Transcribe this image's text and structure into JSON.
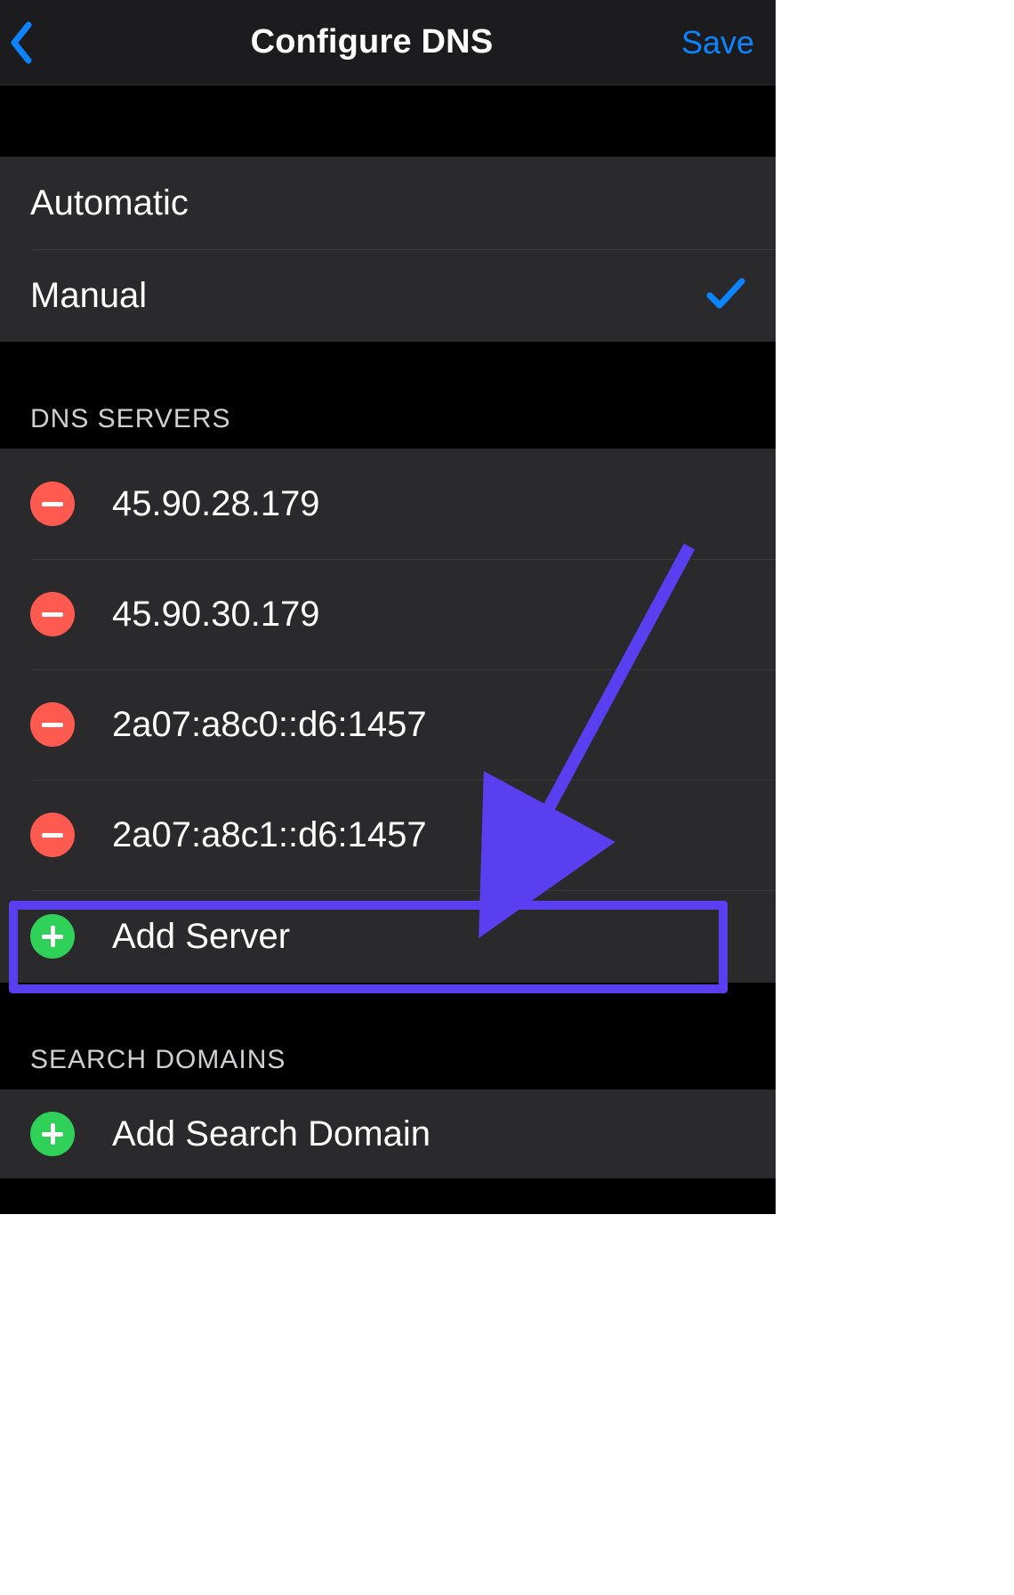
{
  "navbar": {
    "title": "Configure DNS",
    "save_label": "Save"
  },
  "mode": {
    "options": [
      {
        "label": "Automatic",
        "selected": false
      },
      {
        "label": "Manual",
        "selected": true
      }
    ]
  },
  "dns": {
    "header": "DNS SERVERS",
    "servers": [
      "45.90.28.179",
      "45.90.30.179",
      "2a07:a8c0::d6:1457",
      "2a07:a8c1::d6:1457"
    ],
    "add_label": "Add Server"
  },
  "search_domains": {
    "header": "SEARCH DOMAINS",
    "add_label": "Add Search Domain"
  },
  "colors": {
    "accent_blue": "#0a84ff",
    "remove_red": "#ff5a4f",
    "add_green": "#30d158",
    "annotation_purple": "#5a3ff0"
  }
}
